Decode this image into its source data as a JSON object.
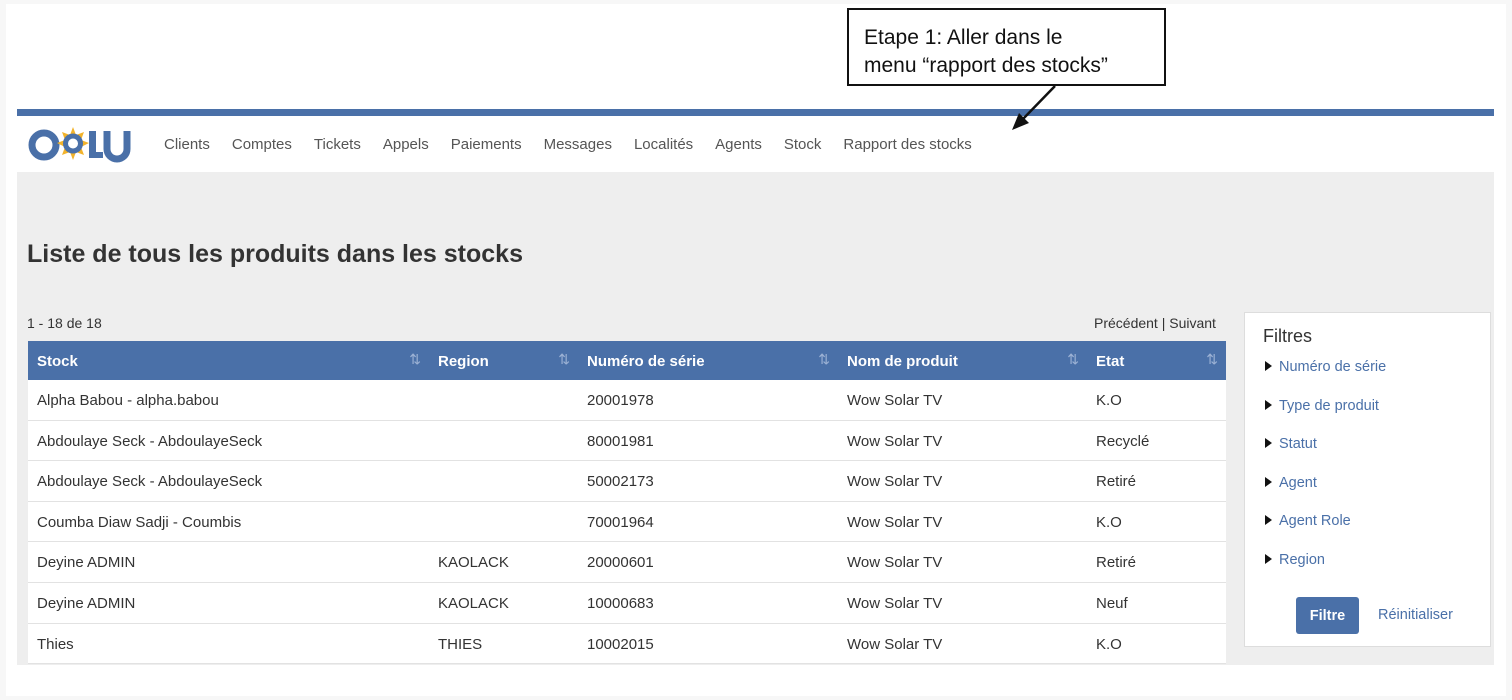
{
  "callout": {
    "line1": "Etape 1: Aller dans le",
    "line2": "menu “rapport des stocks”"
  },
  "brand": {
    "logo_text": "COLU",
    "primary_color": "#4a70a8",
    "sun_color": "#f2b32b"
  },
  "nav": {
    "items": [
      {
        "label": "Clients"
      },
      {
        "label": "Comptes"
      },
      {
        "label": "Tickets"
      },
      {
        "label": "Appels"
      },
      {
        "label": "Paiements"
      },
      {
        "label": "Messages"
      },
      {
        "label": "Localités"
      },
      {
        "label": "Agents"
      },
      {
        "label": "Stock"
      },
      {
        "label": "Rapport des stocks"
      }
    ]
  },
  "page": {
    "title": "Liste de tous les produits dans les stocks",
    "count": "1 - 18 de 18",
    "prev": "Précédent",
    "separator": "|",
    "next": "Suivant"
  },
  "table": {
    "columns": [
      "Stock",
      "Region",
      "Numéro de série",
      "Nom de produit",
      "Etat"
    ],
    "sort_icon": "sort-icon",
    "rows": [
      {
        "stock": "Alpha Babou - alpha.babou",
        "region": "",
        "serial": "20001978",
        "product": "Wow Solar TV",
        "state": "K.O"
      },
      {
        "stock": "Abdoulaye Seck - AbdoulayeSeck",
        "region": "",
        "serial": "80001981",
        "product": "Wow Solar TV",
        "state": "Recyclé"
      },
      {
        "stock": "Abdoulaye Seck - AbdoulayeSeck",
        "region": "",
        "serial": "50002173",
        "product": "Wow Solar TV",
        "state": "Retiré"
      },
      {
        "stock": "Coumba Diaw Sadji - Coumbis",
        "region": "",
        "serial": "70001964",
        "product": "Wow Solar TV",
        "state": "K.O"
      },
      {
        "stock": "Deyine ADMIN",
        "region": "KAOLACK",
        "serial": "20000601",
        "product": "Wow Solar TV",
        "state": "Retiré"
      },
      {
        "stock": "Deyine ADMIN",
        "region": "KAOLACK",
        "serial": "10000683",
        "product": "Wow Solar TV",
        "state": "Neuf"
      },
      {
        "stock": "Thies",
        "region": "THIES",
        "serial": "10002015",
        "product": "Wow Solar TV",
        "state": "K.O"
      }
    ]
  },
  "filters": {
    "title": "Filtres",
    "items": [
      "Numéro de série",
      "Type de produit",
      "Statut",
      "Agent",
      "Agent Role",
      "Region"
    ],
    "filter_button": "Filtre",
    "reset_link": "Réinitialiser"
  }
}
